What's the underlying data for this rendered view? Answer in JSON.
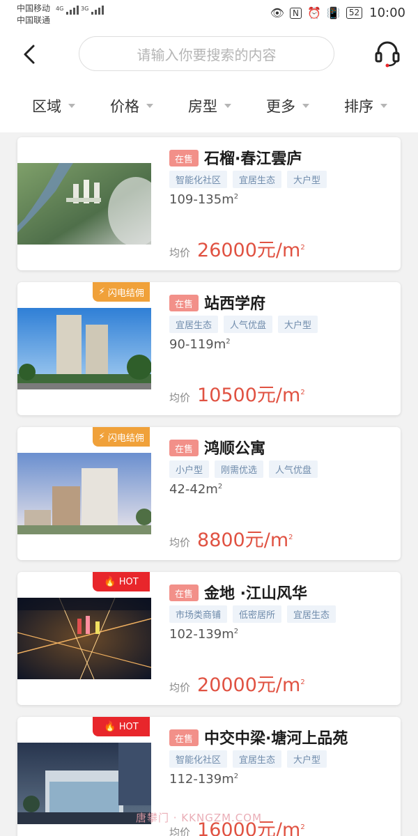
{
  "status_bar": {
    "carrier1": "中国移动",
    "carrier2": "中国联通",
    "net1": "4G",
    "net2": "3G",
    "battery": "52",
    "time": "10:00"
  },
  "header": {
    "search_placeholder": "请输入你要搜索的内容",
    "icons": [
      "back-icon",
      "headset-icon"
    ]
  },
  "filters": [
    {
      "label": "区域"
    },
    {
      "label": "价格"
    },
    {
      "label": "房型"
    },
    {
      "label": "更多"
    },
    {
      "label": "排序"
    }
  ],
  "listings": [
    {
      "status": "在售",
      "name": "石榴·春江雲庐",
      "tags": [
        "智能化社区",
        "宜居生态",
        "大户型"
      ],
      "area": "109-135m",
      "area_sup": "2",
      "price_label": "均价",
      "price": "26000元/m",
      "price_sup": "2",
      "badge": "",
      "badge_type": "none"
    },
    {
      "status": "在售",
      "name": "站西学府",
      "tags": [
        "宜居生态",
        "人气优盘",
        "大户型"
      ],
      "area": "90-119m",
      "area_sup": "2",
      "price_label": "均价",
      "price": "10500元/m",
      "price_sup": "2",
      "badge": "闪电结佣",
      "badge_type": "flash"
    },
    {
      "status": "在售",
      "name": "鸿顺公寓",
      "tags": [
        "小户型",
        "刚需优选",
        "人气优盘"
      ],
      "area": "42-42m",
      "area_sup": "2",
      "price_label": "均价",
      "price": "8800元/m",
      "price_sup": "2",
      "badge": "闪电结佣",
      "badge_type": "flash"
    },
    {
      "status": "在售",
      "name": "金地 ·江山风华",
      "tags": [
        "市场类商铺",
        "低密居所",
        "宜居生态"
      ],
      "area": "102-139m",
      "area_sup": "2",
      "price_label": "均价",
      "price": "20000元/m",
      "price_sup": "2",
      "badge": "HOT",
      "badge_type": "hot"
    },
    {
      "status": "在售",
      "name": "中交中梁·塘河上品苑",
      "tags": [
        "智能化社区",
        "宜居生态",
        "大户型"
      ],
      "area": "112-139m",
      "area_sup": "2",
      "price_label": "均价",
      "price": "16000元/m",
      "price_sup": "2",
      "badge": "HOT",
      "badge_type": "hot"
    }
  ],
  "watermark": "唐攀门 · KKNGZM.COM",
  "colors": {
    "price": "#e05242",
    "sale_badge": "#f29089",
    "flash_badge": "#f0a13a",
    "hot_badge": "#e8262b",
    "tag_text": "#6f8bab",
    "tag_bg": "#eef3f9"
  }
}
